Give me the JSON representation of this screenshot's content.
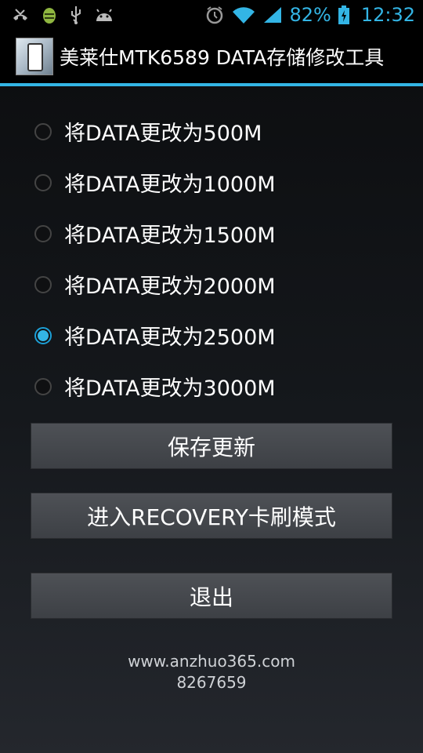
{
  "status_bar": {
    "left_icons": [
      "missed-call-icon",
      "android-debug-icon",
      "usb-icon",
      "android-icon"
    ],
    "right_icons": [
      "alarm-icon",
      "wifi-icon",
      "signal-icon",
      "battery-icon"
    ],
    "battery": "82%",
    "time": "12:32",
    "accent_color": "#33b5e5"
  },
  "app": {
    "title": "美莱仕MTK6589 DATA存储修改工具"
  },
  "options": [
    {
      "label": "将DATA更改为500M",
      "checked": false
    },
    {
      "label": "将DATA更改为1000M",
      "checked": false
    },
    {
      "label": "将DATA更改为1500M",
      "checked": false
    },
    {
      "label": "将DATA更改为2000M",
      "checked": false
    },
    {
      "label": "将DATA更改为2500M",
      "checked": true
    },
    {
      "label": "将DATA更改为3000M",
      "checked": false
    }
  ],
  "buttons": {
    "save": "保存更新",
    "recovery": "进入RECOVERY卡刷模式",
    "exit": "退出"
  },
  "footer": {
    "website": "www.anzhuo365.com",
    "code": "8267659"
  }
}
